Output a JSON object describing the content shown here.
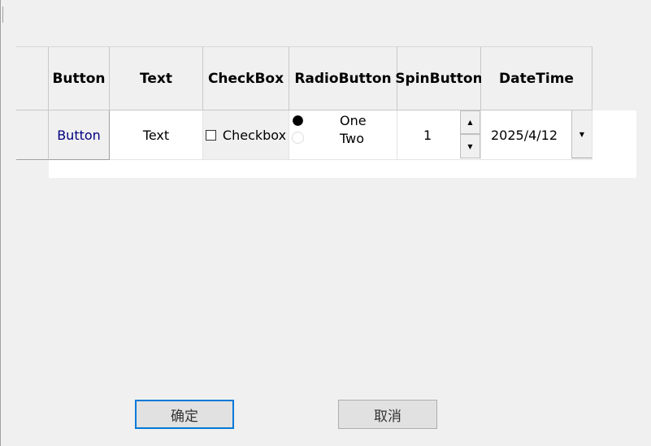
{
  "grid": {
    "headers": [
      "Button",
      "Text",
      "CheckBox",
      "RadioButton",
      "SpinButton",
      "DateTime"
    ],
    "row": {
      "button_label": "Button",
      "text_value": "Text",
      "checkbox_label": "Checkbox",
      "checkbox_checked": false,
      "radio_options": [
        "One",
        "Two"
      ],
      "radio_selected": "One",
      "spin_value": "1",
      "datetime_value": "2025/4/12"
    }
  },
  "dialog": {
    "ok_label": "确定",
    "cancel_label": "取消"
  },
  "icons": {
    "spin_up": "triangle-up-icon",
    "spin_down": "triangle-down-icon",
    "dropdown": "triangle-down-icon"
  },
  "colors": {
    "button_text": "#000080",
    "focus_border": "#0078d7"
  }
}
